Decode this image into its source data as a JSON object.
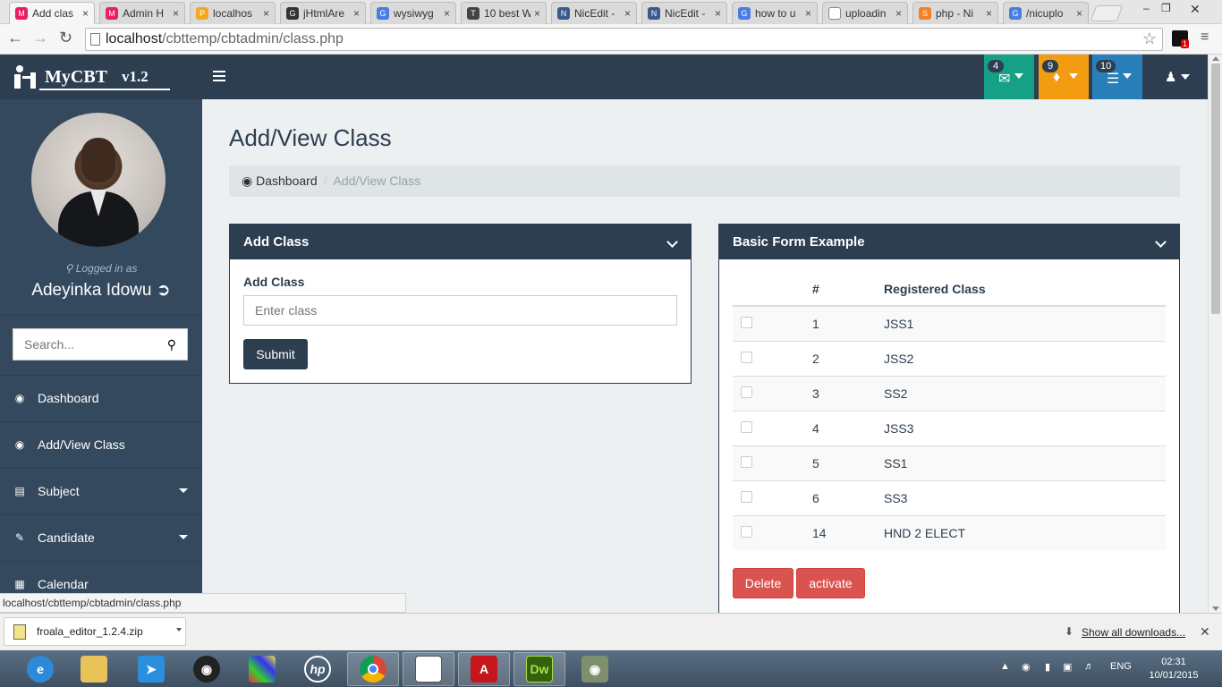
{
  "browser": {
    "tabs": [
      {
        "label": "Add clas",
        "fav": "M",
        "color": "#e91e63",
        "active": true
      },
      {
        "label": "Admin H",
        "fav": "M",
        "color": "#e91e63"
      },
      {
        "label": "localhos",
        "fav": "pma",
        "color": "#f5a623"
      },
      {
        "label": "jHtmlAre",
        "fav": "gh",
        "color": "#333333"
      },
      {
        "label": "wysiwyg",
        "fav": "g",
        "color": "#4a7de2"
      },
      {
        "label": "10 best W",
        "fav": "T",
        "color": "#444444"
      },
      {
        "label": "NicEdit -",
        "fav": "N",
        "color": "#3b5a8c"
      },
      {
        "label": "NicEdit -",
        "fav": "N",
        "color": "#3b5a8c"
      },
      {
        "label": "how to u",
        "fav": "g",
        "color": "#4a7de2"
      },
      {
        "label": "uploadin",
        "fav": "doc",
        "color": "#ffffff"
      },
      {
        "label": "php - Ni",
        "fav": "so",
        "color": "#f48024"
      },
      {
        "label": "/nicuplo",
        "fav": "g",
        "color": "#4a7de2"
      }
    ],
    "url_host": "localhost",
    "url_path": "/cbttemp/cbtadmin/class.php",
    "status_url": "localhost/cbttemp/cbtadmin/class.php"
  },
  "topnav": {
    "brand": "MyCBT",
    "version": "v1.2",
    "badges": [
      {
        "count": "4",
        "icon": "envelope-icon",
        "color": "#16a085"
      },
      {
        "count": "9",
        "icon": "bell-icon",
        "color": "#f39c12"
      },
      {
        "count": "10",
        "icon": "tasks-icon",
        "color": "#2980b9"
      }
    ]
  },
  "sidebar": {
    "logged_in_label": "Logged in as",
    "username": "Adeyinka Idowu",
    "search_placeholder": "Search...",
    "items": [
      {
        "label": "Dashboard",
        "icon": "dashboard-icon"
      },
      {
        "label": "Add/View Class",
        "icon": "dashboard-icon"
      },
      {
        "label": "Subject",
        "icon": "bar-chart-icon",
        "caret": true
      },
      {
        "label": "Candidate",
        "icon": "edit-icon",
        "caret": true
      },
      {
        "label": "Calendar",
        "icon": "calendar-icon"
      }
    ]
  },
  "page": {
    "title": "Add/View Class",
    "breadcrumb_home": "Dashboard",
    "breadcrumb_current": "Add/View Class"
  },
  "add_panel": {
    "title": "Add Class",
    "field_label": "Add Class",
    "field_placeholder": "Enter class",
    "submit_label": "Submit"
  },
  "list_panel": {
    "title": "Basic Form Example",
    "col_num": "#",
    "col_class": "Registered Class",
    "rows": [
      {
        "num": "1",
        "cls": "JSS1"
      },
      {
        "num": "2",
        "cls": "JSS2"
      },
      {
        "num": "3",
        "cls": "SS2"
      },
      {
        "num": "4",
        "cls": "JSS3"
      },
      {
        "num": "5",
        "cls": "SS1"
      },
      {
        "num": "6",
        "cls": "SS3"
      },
      {
        "num": "14",
        "cls": "HND 2 ELECT"
      }
    ],
    "delete_label": "Delete",
    "activate_label": "activate"
  },
  "downloads": {
    "file": "froala_editor_1.2.4.zip",
    "show_all": "Show all downloads..."
  },
  "taskbar": {
    "lang": "ENG",
    "time": "02:31",
    "date": "10/01/2015"
  }
}
